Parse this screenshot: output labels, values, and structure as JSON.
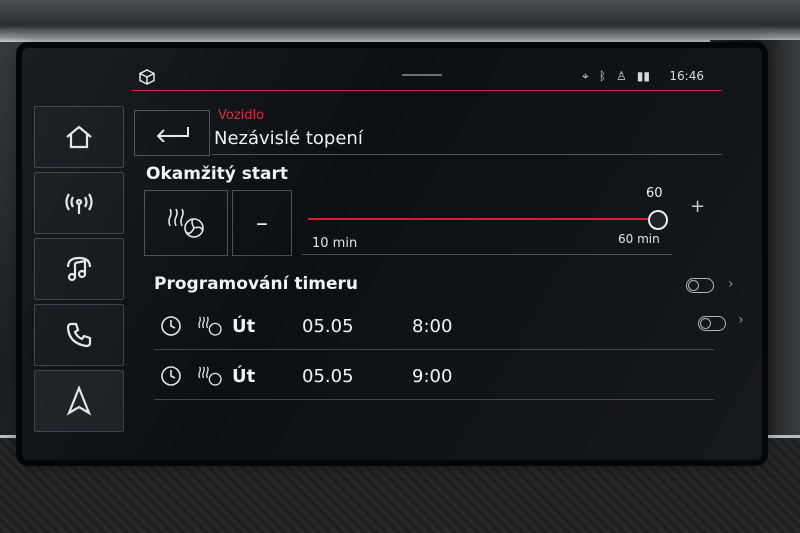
{
  "status": {
    "time": "16:46"
  },
  "header": {
    "breadcrumb": "Vozidlo",
    "title": "Nezávislé topení"
  },
  "instant_start": {
    "title": "Okamžitý start",
    "minus_label": "–",
    "plus_label": "+",
    "slider": {
      "value": "60",
      "min_label": "10 min",
      "max_label": "60 min",
      "fraction": 1.0
    }
  },
  "timers": {
    "title": "Programování timeru",
    "items": [
      {
        "day": "Út",
        "date": "05.05",
        "time": "8:00"
      },
      {
        "day": "Út",
        "date": "05.05",
        "time": "9:00"
      }
    ]
  },
  "colors": {
    "accent": "#d11f35",
    "background": "#0d1013"
  }
}
